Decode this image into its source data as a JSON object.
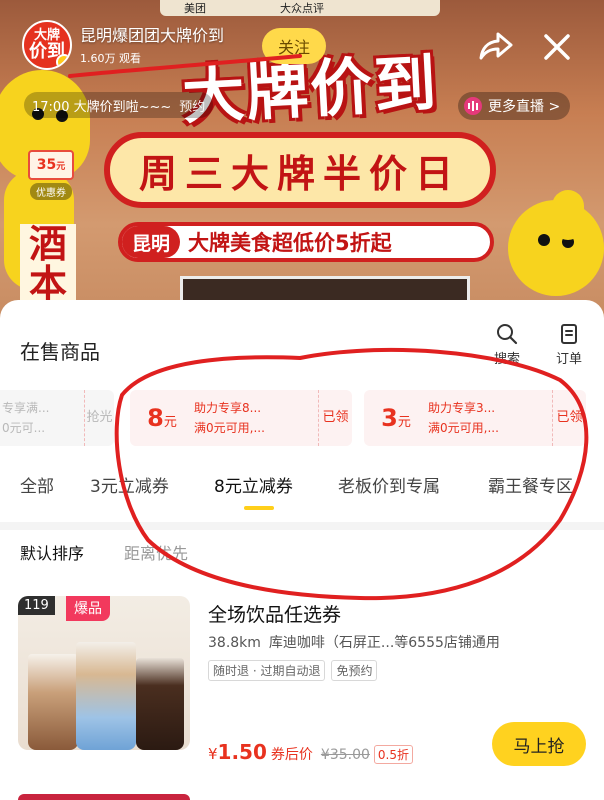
{
  "live": {
    "host_name": "昆明爆团团大牌价到",
    "viewers": "1.60万 观看",
    "follow_label": "关注",
    "schedule_text": "17:00 大牌价到啦~~~",
    "schedule_action": "预约",
    "more_live_label": "更多直播 >",
    "coupon_widget_amount": "35",
    "coupon_widget_unit": "元",
    "coupon_widget_label": "优惠券",
    "avatar_top": "大牌",
    "avatar_mid": "价到",
    "top_strip_left": "美团",
    "top_strip_right": "大众点评",
    "banner_title": "大牌价到",
    "banner_day": "周三大牌半价日",
    "banner_city": "昆明",
    "banner_slogan": "大牌美食超低价5折起",
    "side_sign_1": "酒",
    "side_sign_2": "本"
  },
  "sheet": {
    "title": "在售商品",
    "actions": [
      {
        "label": "搜索",
        "icon": "search-icon"
      },
      {
        "label": "订单",
        "icon": "order-icon"
      }
    ],
    "coupons": [
      {
        "line1": "专享满...",
        "line2": "0元可...",
        "claimed": "抢光",
        "faded": true
      },
      {
        "amount": "8",
        "unit": "元",
        "line1": "助力专享8...",
        "line2": "满0元可用,...",
        "claimed": "已领"
      },
      {
        "amount": "3",
        "unit": "元",
        "line1": "助力专享3...",
        "line2": "满0元可用,...",
        "claimed": "已领"
      }
    ],
    "tabs": [
      "全部",
      "3元立减券",
      "8元立减券",
      "老板价到专属",
      "霸王餐专区"
    ],
    "active_tab": "8元立减券",
    "sort": {
      "default": "默认排序",
      "distance": "距离优先"
    },
    "product": {
      "title": "全场饮品任选券",
      "distance": "38.8km",
      "store": "库迪咖啡（石屏正...等6555店铺通用",
      "badges": [
        "随时退 · 过期自动退",
        "免预约"
      ],
      "price_symbol": "¥",
      "price": "1.50",
      "price_note": "券后价",
      "original_price": "¥35.00",
      "discount": "0.5折",
      "buy_label": "马上抢",
      "tag_number": "119",
      "tag_hot": "爆品"
    }
  },
  "colors": {
    "accent_red": "#e8321f",
    "accent_yellow": "#ffd21f",
    "annotation_red": "#e02020"
  }
}
